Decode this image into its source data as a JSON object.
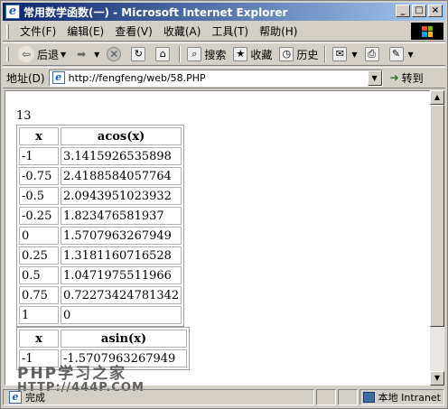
{
  "window": {
    "title": "常用数学函数(一) - Microsoft Internet Explorer",
    "buttons": {
      "minimize": "_",
      "maximize": "□",
      "close": "×"
    }
  },
  "menubar": {
    "items": [
      "文件(F)",
      "编辑(E)",
      "查看(V)",
      "收藏(A)",
      "工具(T)",
      "帮助(H)"
    ]
  },
  "toolbar": {
    "back": "后退",
    "search": "搜索",
    "favorites": "收藏",
    "history": "历史"
  },
  "addressbar": {
    "label": "地址(D)",
    "url": "http://fengfeng/web/58.PHP",
    "go": "转到"
  },
  "content": {
    "count": "13",
    "table1": {
      "headers": [
        "x",
        "acos(x)"
      ],
      "rows": [
        [
          "-1",
          "3.1415926535898"
        ],
        [
          "-0.75",
          "2.4188584057764"
        ],
        [
          "-0.5",
          "2.0943951023932"
        ],
        [
          "-0.25",
          "1.823476581937"
        ],
        [
          "0",
          "1.5707963267949"
        ],
        [
          "0.25",
          "1.3181160716528"
        ],
        [
          "0.5",
          "1.0471975511966"
        ],
        [
          "0.75",
          "0.72273424781342"
        ],
        [
          "1",
          "0"
        ]
      ]
    },
    "table2": {
      "headers": [
        "x",
        "asin(x)"
      ],
      "rows": [
        [
          "-1",
          "-1.5707963267949"
        ]
      ]
    }
  },
  "statusbar": {
    "main": "完成",
    "zone": "本地 Intranet"
  },
  "watermark": {
    "line1": "PHP学习之家",
    "line2": "HTTP://444P.COM"
  }
}
